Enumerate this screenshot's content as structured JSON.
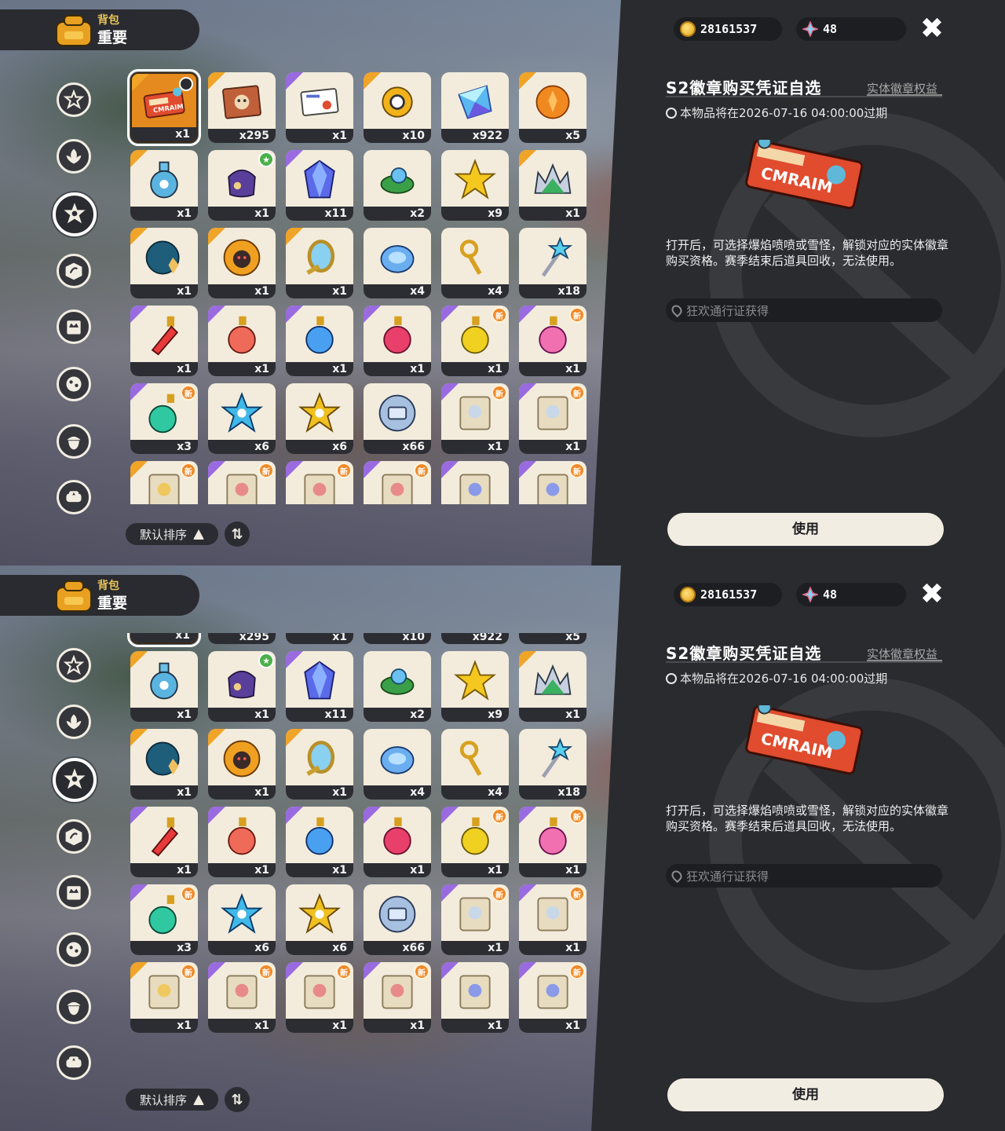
{
  "header": {
    "small": "背包",
    "big": "重要"
  },
  "currency": {
    "gold": "28161537",
    "gem": "48"
  },
  "detail": {
    "title": "S2徽章购买凭证自选",
    "tag": "实体徽章权益",
    "expire": "本物品将在2026-07-16 04:00:00过期",
    "desc": "打开后，可选择爆焰喷喷或雪怪，解锁对应的实体徽章购买资格。赛季结束后道具回收，无法使用。",
    "source": "狂欢通行证获得",
    "use": "使用"
  },
  "sort": {
    "label": "默认排序"
  },
  "badge_new": "新",
  "items": [
    {
      "qty": "x1",
      "corner": "gold",
      "art": "ticket",
      "badge": "clock",
      "selected": true
    },
    {
      "qty": "x295",
      "corner": "gold",
      "art": "card",
      "badge": ""
    },
    {
      "qty": "x1",
      "corner": "purple",
      "art": "letter",
      "badge": ""
    },
    {
      "qty": "x10",
      "corner": "gold",
      "art": "gear",
      "badge": ""
    },
    {
      "qty": "x922",
      "corner": "",
      "art": "crystal",
      "badge": ""
    },
    {
      "qty": "x5",
      "corner": "gold",
      "art": "orange",
      "badge": ""
    },
    {
      "qty": "x1",
      "corner": "gold",
      "art": "bottle",
      "badge": ""
    },
    {
      "qty": "x1",
      "corner": "",
      "art": "bag",
      "badge": "green"
    },
    {
      "qty": "x11",
      "corner": "purple",
      "art": "gem",
      "badge": ""
    },
    {
      "qty": "x2",
      "corner": "",
      "art": "leaf",
      "badge": ""
    },
    {
      "qty": "x9",
      "corner": "",
      "art": "star",
      "badge": ""
    },
    {
      "qty": "x1",
      "corner": "gold",
      "art": "crown",
      "badge": ""
    },
    {
      "qty": "x1",
      "corner": "gold",
      "art": "shell",
      "badge": ""
    },
    {
      "qty": "x1",
      "corner": "gold",
      "art": "sun",
      "badge": ""
    },
    {
      "qty": "x1",
      "corner": "gold",
      "art": "mirror",
      "badge": ""
    },
    {
      "qty": "x4",
      "corner": "",
      "art": "blob",
      "badge": ""
    },
    {
      "qty": "x4",
      "corner": "",
      "art": "key",
      "badge": ""
    },
    {
      "qty": "x18",
      "corner": "",
      "art": "wand",
      "badge": ""
    },
    {
      "qty": "x1",
      "corner": "purple",
      "art": "potion-red",
      "badge": ""
    },
    {
      "qty": "x1",
      "corner": "purple",
      "art": "potion-coral",
      "badge": ""
    },
    {
      "qty": "x1",
      "corner": "purple",
      "art": "potion-blue",
      "badge": ""
    },
    {
      "qty": "x1",
      "corner": "purple",
      "art": "potion-pink",
      "badge": ""
    },
    {
      "qty": "x1",
      "corner": "purple",
      "art": "potion-yellow",
      "badge": "new"
    },
    {
      "qty": "x1",
      "corner": "purple",
      "art": "potion-heart",
      "badge": "new"
    },
    {
      "qty": "x3",
      "corner": "purple",
      "art": "potion-green",
      "badge": "new"
    },
    {
      "qty": "x6",
      "corner": "",
      "art": "star-blue",
      "badge": ""
    },
    {
      "qty": "x6",
      "corner": "",
      "art": "star-gold",
      "badge": ""
    },
    {
      "qty": "x66",
      "corner": "",
      "art": "coin-robot",
      "badge": ""
    },
    {
      "qty": "x1",
      "corner": "purple",
      "art": "scroll",
      "badge": "new"
    },
    {
      "qty": "x1",
      "corner": "purple",
      "art": "scroll",
      "badge": "new"
    },
    {
      "qty": "x1",
      "corner": "gold",
      "art": "scroll-y",
      "badge": "new"
    },
    {
      "qty": "x1",
      "corner": "purple",
      "art": "scroll-r",
      "badge": "new"
    },
    {
      "qty": "x1",
      "corner": "purple",
      "art": "scroll-r",
      "badge": "new"
    },
    {
      "qty": "x1",
      "corner": "purple",
      "art": "scroll-r",
      "badge": "new"
    },
    {
      "qty": "x1",
      "corner": "purple",
      "art": "scroll-b",
      "badge": ""
    },
    {
      "qty": "x1",
      "corner": "purple",
      "art": "scroll-b",
      "badge": "new"
    }
  ],
  "colors": {
    "panel": "#2a2b2f",
    "accent": "#e58a1f",
    "tile": "#f3ecdc"
  }
}
